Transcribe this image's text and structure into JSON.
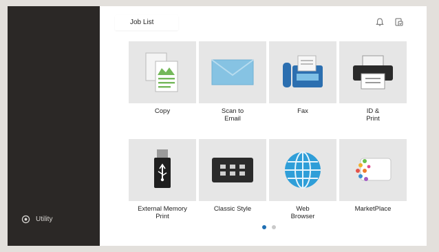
{
  "header": {
    "job_list_label": "Job List"
  },
  "sidebar": {
    "utility_label": "Utility"
  },
  "tiles": [
    {
      "label": "Copy"
    },
    {
      "label": "Scan to\nEmail"
    },
    {
      "label": "Fax"
    },
    {
      "label": "ID &\nPrint"
    },
    {
      "label": "External Memory\nPrint"
    },
    {
      "label": "Classic Style"
    },
    {
      "label": "Web\nBrowser"
    },
    {
      "label": "MarketPlace"
    }
  ],
  "pager": {
    "pages": 2,
    "active_page": 1
  },
  "colors": {
    "sidebar": "#2b2826",
    "accent": "#1f6fb3",
    "tile_bg": "#e6e6e6"
  }
}
